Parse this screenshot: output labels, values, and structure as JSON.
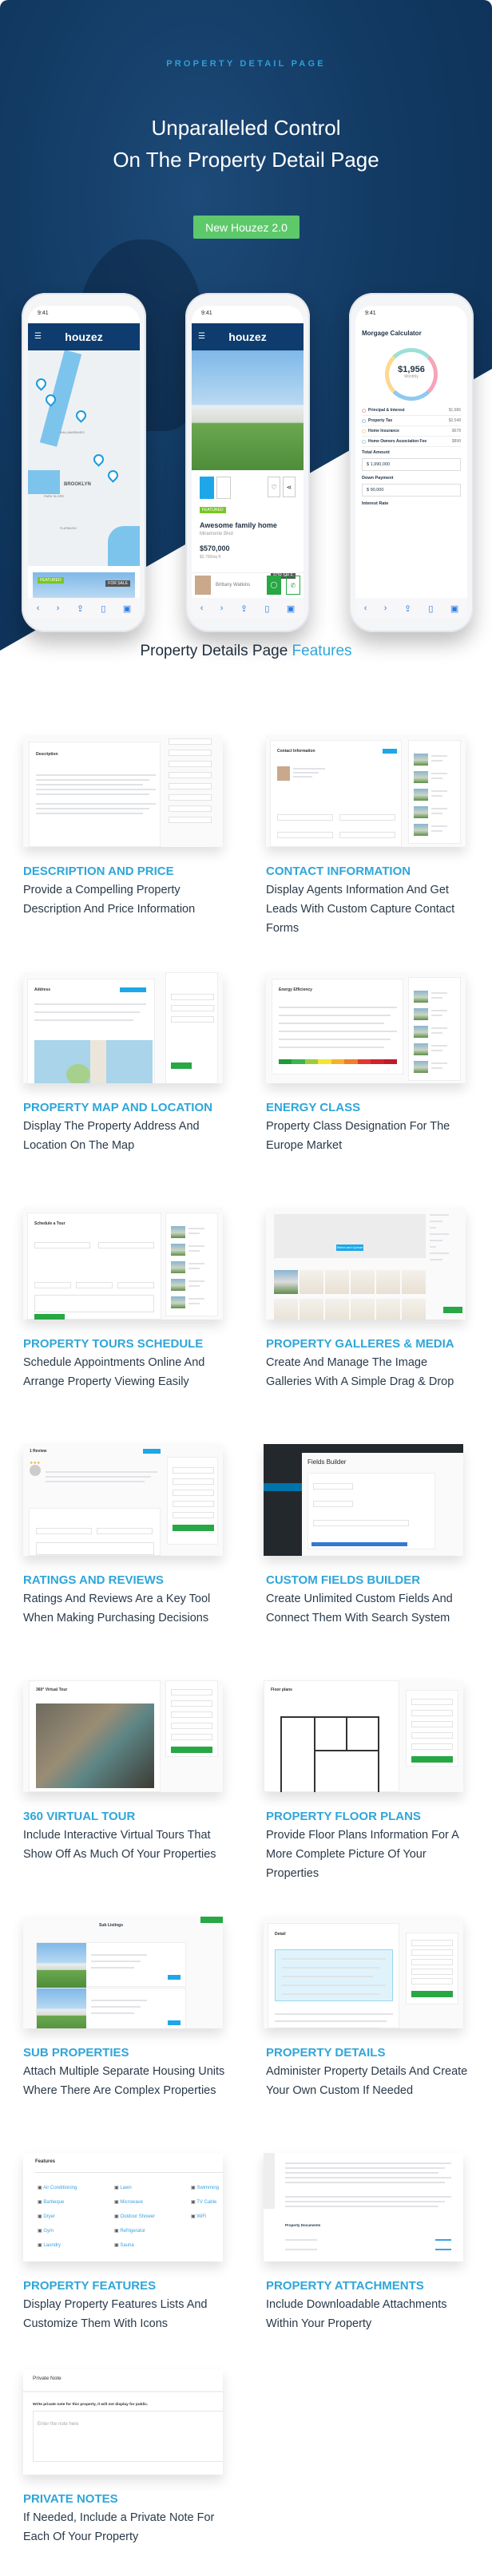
{
  "hero": {
    "eyebrow": "PROPERTY DETAIL PAGE",
    "headline_1": "Unparalleled Control",
    "headline_2": "On The Property Detail Page",
    "cta": "New Houzez 2.0",
    "colors": {
      "background": "#0e3460",
      "accent": "#2f9fd8",
      "cta": "#5ec96a"
    }
  },
  "phones": {
    "time": "9:41",
    "brand": "houzez",
    "map": {
      "map_labels": [
        "BROOKLYN",
        "WILLIAMSBURG",
        "PARK SLOPE",
        "FLATBUSH"
      ],
      "card_badge": "FEATURED",
      "card_status": "FOR SALE"
    },
    "listing": {
      "badge": "FEATURED",
      "title": "Awesome family home",
      "address": "Miramonte Blvd",
      "price": "$570,000",
      "price_per": "$2,700/sq ft",
      "status": "FOR SALE",
      "agent": "Brittany Watkins"
    },
    "mortgage": {
      "title": "Morgage Calculator",
      "amount": "$1,956",
      "period": "Monthly",
      "rows": [
        {
          "label": "Principal & Interest",
          "value": "$1,686"
        },
        {
          "label": "Property Tax",
          "value": "$2,548"
        },
        {
          "label": "Home Insurance",
          "value": "$678"
        },
        {
          "label": "Home Owners Association Fee",
          "value": "$898"
        }
      ],
      "total_label": "Total Amount",
      "total_value": "1,990,000",
      "down_label": "Down Payment",
      "down_value": "90,000",
      "rate_label": "Interest Rate",
      "currency": "$"
    }
  },
  "section": {
    "title_a": "Property Details Page ",
    "title_b": "Features"
  },
  "features": [
    {
      "title": "DESCRIPTION AND PRICE",
      "desc": "Provide a Compelling Property Description And Price Information",
      "shot": "Description"
    },
    {
      "title": "CONTACT INFORMATION",
      "desc": "Display Agents Information And Get Leads With Custom Capture Contact Forms",
      "shot": "Contact Information"
    },
    {
      "title": "PROPERTY MAP AND LOCATION",
      "desc": "Display The Property Address And Location On The Map",
      "shot": "Address"
    },
    {
      "title": "ENERGY CLASS",
      "desc": "Property Class Designation For The Europe Market",
      "shot": "Energy Efficiency"
    },
    {
      "title": "PROPERTY TOURS SCHEDULE",
      "desc": "Schedule Appointments Online And Arrange Property Viewing Easily",
      "shot": "Schedule a Tour"
    },
    {
      "title": "PROPERTY GALLERES & MEDIA",
      "desc": "Create And Manage The Image Galleries With A Simple Drag & Drop",
      "shot": "Select and Upload"
    },
    {
      "title": "RATINGS AND REVIEWS",
      "desc": "Ratings And Reviews Are a Key Tool When Making Purchasing Decisions",
      "shot": "1 Review"
    },
    {
      "title": "CUSTOM FIELDS BUILDER",
      "desc": "Create Unlimited Custom Fields And Connect Them With Search System",
      "shot": "Fields Builder"
    },
    {
      "title": "360 VIRTUAL TOUR",
      "desc": "Include Interactive Virtual Tours That Show Off As Much Of Your Properties",
      "shot": "360° Virtual Tour"
    },
    {
      "title": "PROPERTY FLOOR PLANS",
      "desc": "Provide Floor Plans Information For A More Complete Picture Of Your Properties",
      "shot": "Floor plans"
    },
    {
      "title": "SUB PROPERTIES",
      "desc": "Attach Multiple Separate Housing Units Where There Are Complex Properties",
      "shot": "Sub Listings"
    },
    {
      "title": "PROPERTY DETAILS",
      "desc": "Administer Property Details And Create Your Own Custom If Needed",
      "shot": "Detail"
    },
    {
      "title": "PROPERTY FEATURES",
      "desc": "Display Property Features Lists And Customize Them With Icons",
      "shot": "Features",
      "items": [
        "Air Conditioning",
        "Barbeque",
        "Dryer",
        "Gym",
        "Laundry",
        "Lawn",
        "Microwave",
        "Outdoor Shower",
        "Refrigerator",
        "Sauna",
        "Swimming",
        "TV Cable",
        "WiFi"
      ]
    },
    {
      "title": "PROPERTY ATTACHMENTS",
      "desc": "Include Downloadable Attachments Within Your Property",
      "shot": "Property Documents"
    },
    {
      "title": "PRIVATE NOTES",
      "desc": "If Needed, Include a Private Note For Each Of Your Property",
      "shot": "Private Note",
      "note_label": "Write private note for this property, it will not display for public.",
      "note_placeholder": "Enter the note here"
    }
  ]
}
